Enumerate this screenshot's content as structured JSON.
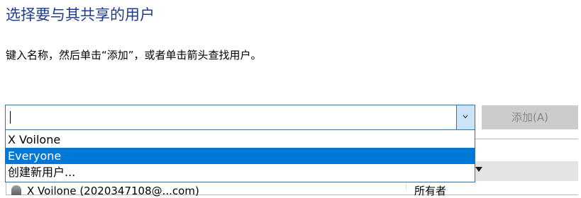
{
  "dialog": {
    "title": "选择要与其共享的用户",
    "instruction": "键入名称，然后单击“添加”，或者单击箭头查找用户。"
  },
  "combo": {
    "value": "",
    "options": [
      "X Voilone",
      "Everyone",
      "创建新用户..."
    ],
    "selected_index": 1
  },
  "add_button": {
    "label": "添加(A)",
    "enabled": false
  },
  "share_list": {
    "rows": [
      {
        "name": "X Voilone (2020347108@...com)",
        "permission": "所有者"
      }
    ]
  },
  "colors": {
    "title": "#1d3c8f",
    "accent": "#0078d7",
    "focus_border": "#1979ca",
    "combo_button_bg": "#cce4f7",
    "disabled_button_bg": "#cccccc",
    "disabled_text": "#888888"
  },
  "icons": {
    "combo_toggle": "chevron-down-icon",
    "sort": "sort-descending-icon",
    "user": "user-icon"
  }
}
